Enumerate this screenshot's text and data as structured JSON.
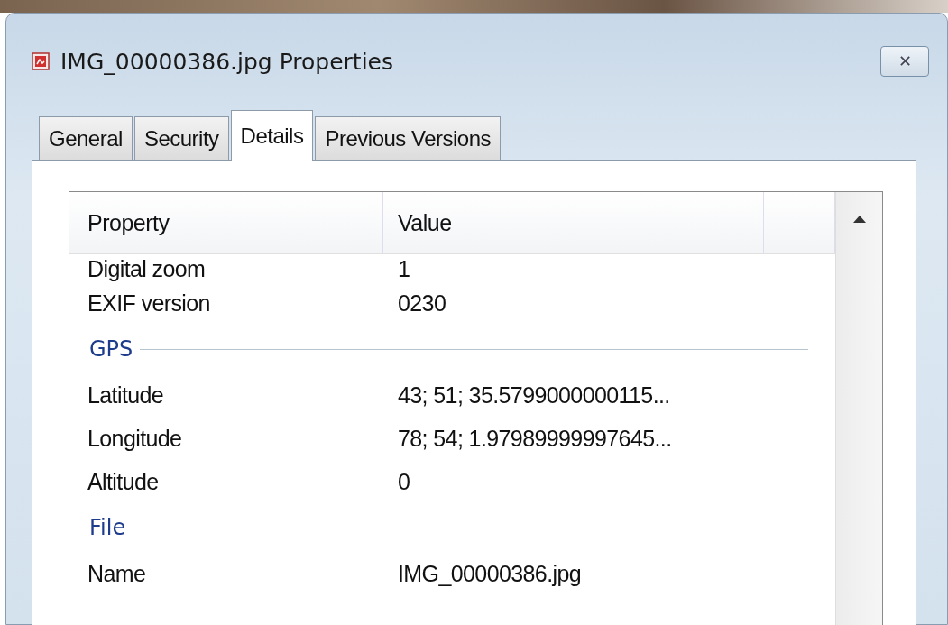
{
  "window": {
    "title": "IMG_00000386.jpg Properties",
    "close": "✕"
  },
  "tabs": [
    {
      "label": "General",
      "selected": false
    },
    {
      "label": "Security",
      "selected": false
    },
    {
      "label": "Details",
      "selected": true
    },
    {
      "label": "Previous Versions",
      "selected": false
    }
  ],
  "table": {
    "columns": [
      "Property",
      "Value"
    ],
    "rows": [
      {
        "kind": "row",
        "property": "Digital zoom",
        "value": "1"
      },
      {
        "kind": "row",
        "property": "EXIF version",
        "value": "0230"
      },
      {
        "kind": "group",
        "label": "GPS"
      },
      {
        "kind": "row",
        "property": "Latitude",
        "value": "43; 51; 35.5799000000115..."
      },
      {
        "kind": "row",
        "property": "Longitude",
        "value": "78; 54; 1.97989999997645..."
      },
      {
        "kind": "row",
        "property": "Altitude",
        "value": "0"
      },
      {
        "kind": "group",
        "label": "File"
      },
      {
        "kind": "row",
        "property": "Name",
        "value": "IMG_00000386.jpg"
      }
    ]
  }
}
